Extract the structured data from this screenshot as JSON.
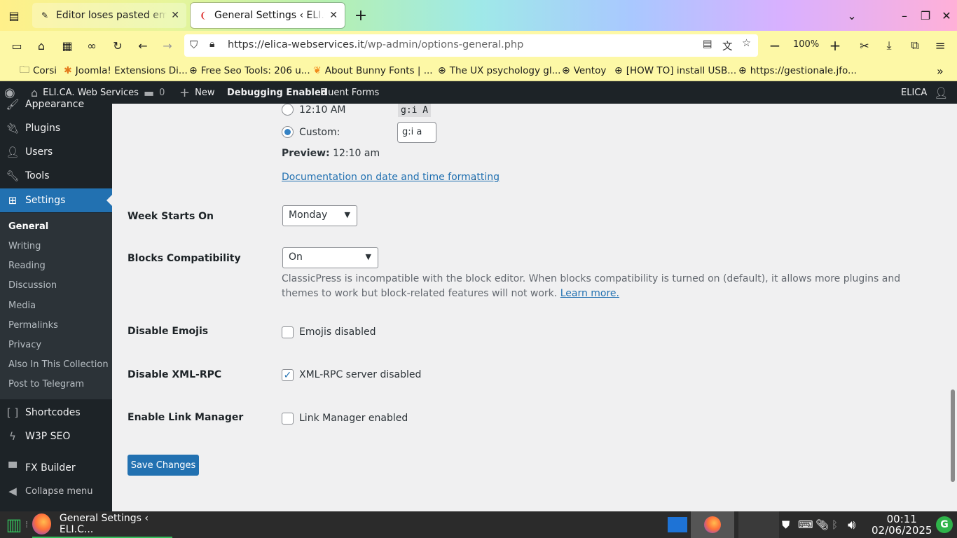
{
  "browser": {
    "tabs": [
      {
        "title": "Editor loses pasted emojis",
        "active": false
      },
      {
        "title": "General Settings ‹ ELI.CA. W",
        "active": true
      }
    ],
    "url_domain": "https://elica-webservices.it",
    "url_path": "/wp-admin/options-general.php",
    "zoom": "100%",
    "bookmarks": [
      "Corsi",
      "Joomla! Extensions Di...",
      "Free Seo Tools: 206 u...",
      "About Bunny Fonts | ...",
      "The UX psychology gl...",
      "Ventoy",
      "[HOW TO] install USB...",
      "https://gestionale.jfo..."
    ]
  },
  "adminbar": {
    "site_name": "ELI.CA. Web Services",
    "comments_count": "0",
    "new_label": "New",
    "debugging": "Debugging Enabled",
    "fluent_forms": "Fluent Forms",
    "user": "ELICA"
  },
  "sidebar": {
    "items": {
      "appearance": "Appearance",
      "plugins": "Plugins",
      "users": "Users",
      "tools": "Tools",
      "settings": "Settings",
      "shortcodes": "Shortcodes",
      "w3pseo": "W3P SEO",
      "fxbuilder": "FX Builder",
      "collapse": "Collapse menu"
    },
    "submenu": {
      "general": "General",
      "writing": "Writing",
      "reading": "Reading",
      "discussion": "Discussion",
      "media": "Media",
      "permalinks": "Permalinks",
      "privacy": "Privacy",
      "collection": "Also In This Collection",
      "telegram": "Post to Telegram"
    }
  },
  "settings": {
    "time_option_12": "12:10 AM",
    "time_format_code": "g:i A",
    "custom_label": "Custom:",
    "custom_value": "g:i a",
    "preview_label": "Preview:",
    "preview_value": "12:10 am",
    "doc_link": "Documentation on date and time formatting",
    "week_starts_label": "Week Starts On",
    "week_starts_value": "Monday",
    "blocks_label": "Blocks Compatibility",
    "blocks_value": "On",
    "blocks_desc": "ClassicPress is incompatible with the block editor. When blocks compatibility is turned on (default), it allows more plugins and themes to work but block-related features will not work.",
    "learn_more": "Learn more.",
    "emoji_label": "Disable Emojis",
    "emoji_option": "Emojis disabled",
    "xmlrpc_label": "Disable XML-RPC",
    "xmlrpc_option": "XML-RPC server disabled",
    "link_label": "Enable Link Manager",
    "link_option": "Link Manager enabled",
    "save_button": "Save Changes"
  },
  "taskbar": {
    "window_title": "General Settings ‹ ELI.C...",
    "time": "00:11",
    "date": "02/06/2025"
  },
  "colors": {
    "wp_dark": "#1d2327",
    "wp_blue": "#2271b1",
    "wp_bg": "#f0f0f1"
  }
}
